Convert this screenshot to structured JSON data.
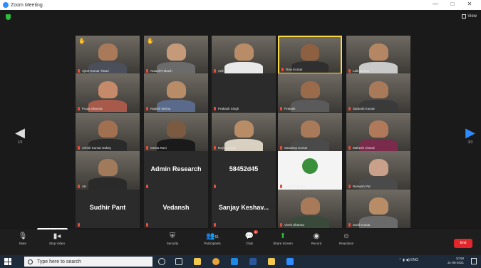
{
  "window": {
    "title": "Zoom Meeting",
    "controls": [
      "—",
      "□",
      "✕"
    ]
  },
  "view_button": {
    "label": "View"
  },
  "page_nav": {
    "prev_page": "1/3",
    "next_page": "3/3"
  },
  "tiles": [
    {
      "name": "Ajeet Kumar Tiwari",
      "hand": true,
      "video": true,
      "skin": "#a87a5a",
      "shirt": "#4a4f5a"
    },
    {
      "name": "Anand Prakash",
      "hand": true,
      "video": true,
      "skin": "#c49a7a",
      "shirt": "#6b6b6b"
    },
    {
      "name": "Anil Sharma",
      "hand": false,
      "video": true,
      "skin": "#b88c66",
      "shirt": "#e8e8e8"
    },
    {
      "name": "Ravi Kumar",
      "hand": false,
      "video": true,
      "skin": "#8c6040",
      "shirt": "#2f2f2f",
      "active": true
    },
    {
      "name": "Lalit Mohan",
      "hand": false,
      "video": true,
      "skin": "#b58663",
      "shirt": "#c9c9c9"
    },
    {
      "name": "Pooja Sharma",
      "hand": false,
      "video": true,
      "skin": "#c58a6a",
      "shirt": "#a85a4a"
    },
    {
      "name": "Rajesh Verma",
      "hand": false,
      "video": true,
      "skin": "#b88c66",
      "shirt": "#5a6a8a"
    },
    {
      "name": "Prakash Singh",
      "hand": false,
      "video": false
    },
    {
      "name": "Prateek",
      "hand": false,
      "video": true,
      "skin": "#9a6b4a",
      "shirt": "#5a5a5a"
    },
    {
      "name": "Santosh Kumar",
      "hand": false,
      "video": true,
      "skin": "#a87a5a",
      "shirt": "#3a3a3a"
    },
    {
      "name": "Ashok Kumar Dubey",
      "hand": false,
      "video": true,
      "skin": "#a07050",
      "shirt": "#2a2a2a"
    },
    {
      "name": "Geeta Rani",
      "hand": false,
      "video": true,
      "skin": "#7a5a40",
      "shirt": "#1a1a1a"
    },
    {
      "name": "Rajiv Ranjan",
      "hand": false,
      "video": true,
      "skin": "#b88c66",
      "shirt": "#d8d0c0"
    },
    {
      "name": "Sandeep Kumar",
      "hand": false,
      "video": true,
      "skin": "#a87a5a",
      "shirt": "#4a4a4a"
    },
    {
      "name": "Mahesh Chand",
      "hand": false,
      "video": true,
      "skin": "#b07a5a",
      "shirt": "#7a2a4a"
    },
    {
      "name": "AK",
      "hand": false,
      "video": true,
      "skin": "#a07a5a",
      "shirt": "#2a2a2a"
    },
    {
      "name": "Admin Research",
      "hand": false,
      "video": false,
      "big": true
    },
    {
      "name": "58452d45",
      "hand": false,
      "video": false,
      "big": true
    },
    {
      "name": "Swachh Bharat",
      "hand": false,
      "video": true,
      "logo": true
    },
    {
      "name": "Ramesh Pal",
      "hand": false,
      "video": true,
      "skin": "#c9a08a",
      "shirt": "#4a4a4a"
    },
    {
      "name": "Sudhir Pant",
      "hand": false,
      "video": false,
      "big": true
    },
    {
      "name": "Vedansh",
      "hand": false,
      "video": false,
      "big": true
    },
    {
      "name": "Sanjay Keshav...",
      "hand": false,
      "video": false,
      "big": true
    },
    {
      "name": "Vivek Sharma",
      "hand": false,
      "video": true,
      "skin": "#a87a5a",
      "shirt": "#3a4a3a"
    },
    {
      "name": "Sunil Kumar",
      "hand": false,
      "video": true,
      "skin": "#b88c66",
      "shirt": "#6a6a6a"
    }
  ],
  "toolbar": {
    "mute": "Mute",
    "stop_video": "Stop Video",
    "security": "Security",
    "participants": "Participants",
    "participants_count": "61",
    "chat": "Chat",
    "chat_badge": "1",
    "share_screen": "Share Screen",
    "record": "Record",
    "reactions": "Reactions",
    "end": "End",
    "tooltip": "Start Video (Alt+V)"
  },
  "taskbar": {
    "search_placeholder": "Type here to search",
    "time": "10:58",
    "date": "31-08-2021",
    "lang": "ENG"
  },
  "colors": {
    "accent": "#2d8cff",
    "end": "#e0262b",
    "active_speaker": "#f6d84a",
    "security_green": "#2dbd3a"
  }
}
